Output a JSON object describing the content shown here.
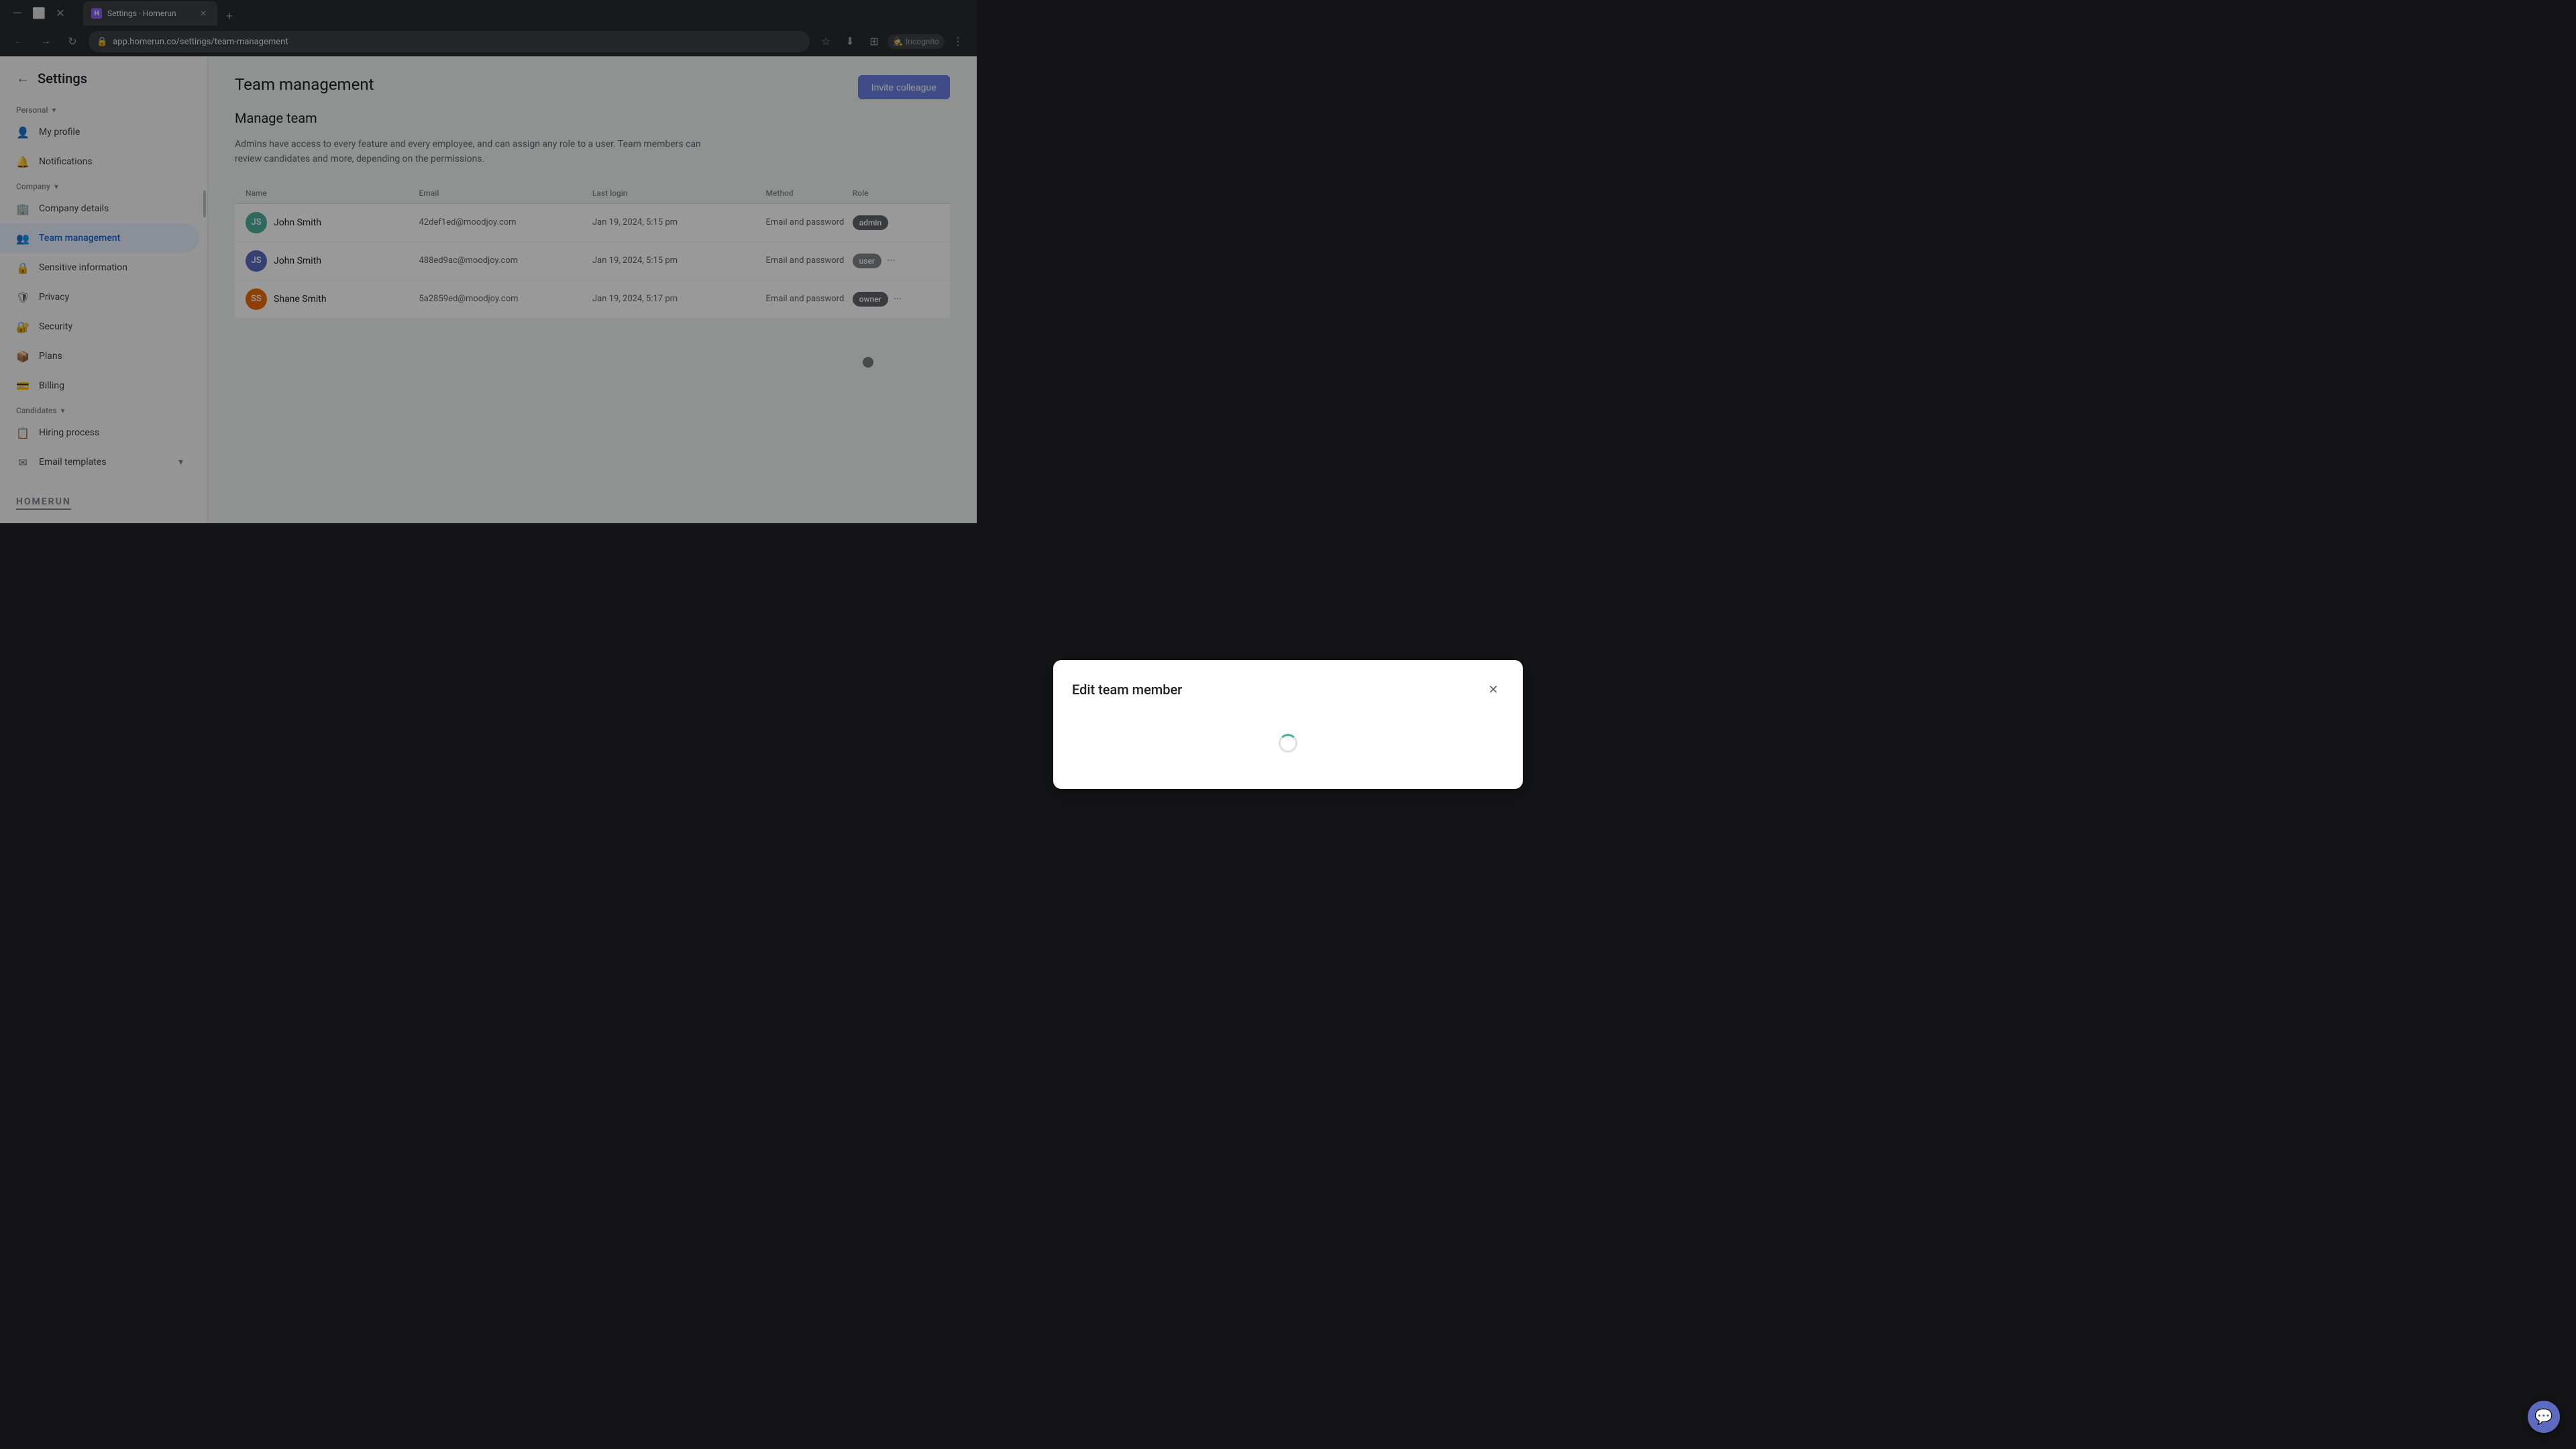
{
  "browser": {
    "tab_label": "Settings · Homerun",
    "tab_favicon": "H",
    "url": "app.homerun.co/settings/team-management",
    "incognito_label": "Incognito"
  },
  "sidebar": {
    "back_label": "Settings",
    "personal_section": "Personal",
    "company_section": "Company",
    "candidates_section": "Candidates",
    "items": {
      "my_profile": "My profile",
      "notifications": "Notifications",
      "company_details": "Company details",
      "team_management": "Team management",
      "sensitive_information": "Sensitive information",
      "privacy": "Privacy",
      "security": "Security",
      "plans": "Plans",
      "billing": "Billing",
      "hiring_process": "Hiring process",
      "email_templates": "Email templates"
    },
    "logo": "HOMERUN"
  },
  "main": {
    "page_title": "Team management",
    "section_title": "Manage team",
    "section_desc": "Admins have access to every feature and every employee, and can assign any role to a user. Team members can review candidates and more, depending on the permissions.",
    "invite_btn": "Invite colleague",
    "table_columns": {
      "name": "Name",
      "email": "Email",
      "last_login": "Last login",
      "method": "Method",
      "role": "Role"
    },
    "rows": [
      {
        "name": "John Smith",
        "email": "42def1ed@moodjoy.com",
        "last_login": "Jan 19, 2024, 5:15 pm",
        "method": "Email and password",
        "role": "admin",
        "avatar_color": "#4caf9a",
        "avatar_initials": "JS"
      },
      {
        "name": "John Smith",
        "email": "488ed9ac@moodjoy.com",
        "last_login": "Jan 19, 2024, 5:15 pm",
        "method": "Email and password",
        "role": "user",
        "avatar_color": "#5c6bc0",
        "avatar_initials": "JS"
      },
      {
        "name": "Shane Smith",
        "email": "5a2859ed@moodjoy.com",
        "last_login": "Jan 19, 2024, 5:17 pm",
        "method": "Email and password",
        "role": "owner",
        "avatar_color": "#ef6c00",
        "avatar_initials": "SS"
      }
    ]
  },
  "modal": {
    "title": "Edit team member",
    "close_icon": "✕"
  },
  "chat_btn_icon": "💬"
}
